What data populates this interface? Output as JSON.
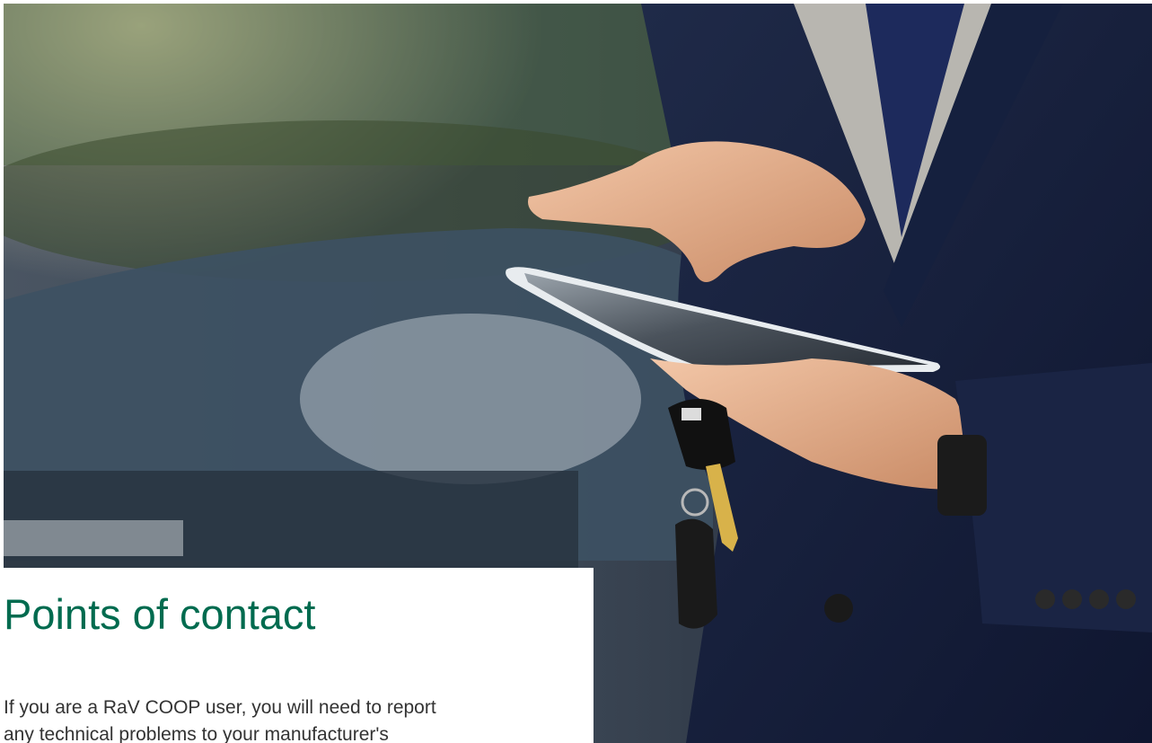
{
  "article": {
    "heading": "Points of contact",
    "body_line_1": "If you are a RaV COOP user, you will need to report",
    "body_line_2": "any technical problems to your manufacturer's"
  },
  "colors": {
    "heading": "#006b4f",
    "body_text": "#333333",
    "card_background": "#ffffff"
  },
  "hero_image": {
    "subject": "person-tapping-tablet-holding-car-key-photo"
  }
}
